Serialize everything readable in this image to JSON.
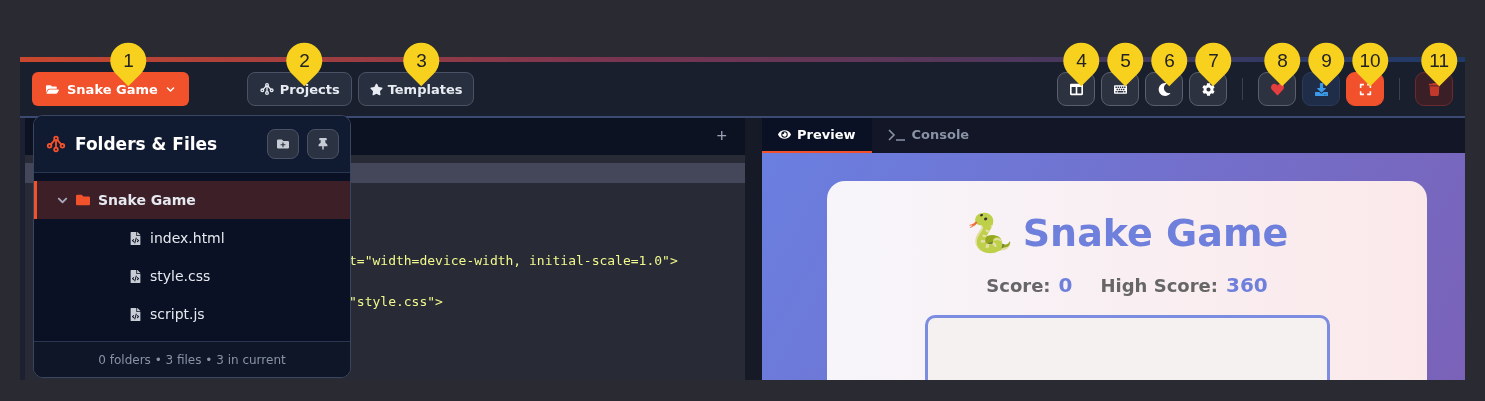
{
  "toolbar": {
    "project_button": {
      "label": "Snake Game",
      "callout": "1"
    },
    "nav_buttons": [
      {
        "label": "Projects",
        "callout": "2"
      },
      {
        "label": "Templates",
        "callout": "3"
      }
    ],
    "tool_buttons": [
      {
        "kind": "plain",
        "callout": "4"
      },
      {
        "kind": "plain",
        "callout": "5"
      },
      {
        "kind": "plain",
        "callout": "6"
      },
      {
        "kind": "plain",
        "callout": "7"
      },
      {
        "kind": "favorite",
        "callout": "8"
      },
      {
        "kind": "download",
        "callout": "9"
      },
      {
        "kind": "active",
        "callout": "10"
      },
      {
        "kind": "danger",
        "callout": "11"
      }
    ]
  },
  "editor": {
    "add_tab": "+",
    "code_lines": [
      {
        "text": "t=\"width=device-width, initial-scale=1.0\">"
      },
      {
        "text": "\"style.css\">"
      }
    ]
  },
  "file_panel": {
    "title": "Folders & Files",
    "tree": [
      {
        "name": "Snake Game",
        "kind": "folder",
        "expanded": true,
        "selected": true,
        "children": [
          {
            "name": "index.html",
            "kind": "file",
            "selected": false
          },
          {
            "name": "style.css",
            "kind": "file",
            "selected": false
          },
          {
            "name": "script.js",
            "kind": "file",
            "selected": false
          }
        ]
      }
    ],
    "footer": "0 folders • 3 files • 3 in current"
  },
  "preview": {
    "tabs": [
      {
        "label": "Preview",
        "selected": true
      },
      {
        "label": "Console",
        "selected": false
      }
    ],
    "game": {
      "emoji": "🐍",
      "title": "Snake Game",
      "score_label": "Score:",
      "score": "0",
      "high_label": "High Score:",
      "high_score": "360"
    }
  }
}
